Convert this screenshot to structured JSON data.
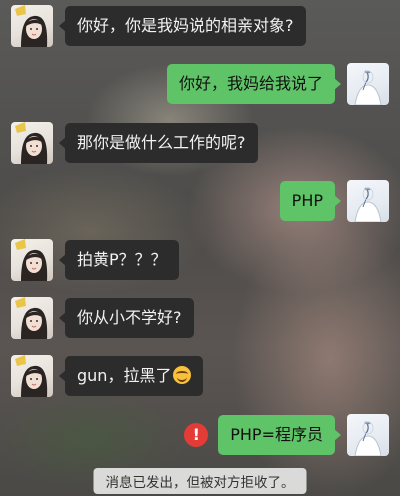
{
  "chat": {
    "messages": [
      {
        "side": "left",
        "text": "你好，你是我妈说的相亲对象?"
      },
      {
        "side": "right",
        "text": "你好，我妈给我说了"
      },
      {
        "side": "left",
        "text": "那你是做什么工作的呢?"
      },
      {
        "side": "right",
        "text": "PHP"
      },
      {
        "side": "left",
        "text": "拍黄P？？？"
      },
      {
        "side": "left",
        "text": "你从小不学好?"
      },
      {
        "side": "left",
        "text": "gun，拉黑了",
        "emoji": "smile-emoji"
      },
      {
        "side": "right",
        "text": "PHP=程序员",
        "status": "send-failed-icon"
      }
    ],
    "system_notice": "消息已发出，但被对方拒收了。",
    "warning_glyph": "!"
  },
  "colors": {
    "incoming_bubble": "#2c2c2c",
    "outgoing_bubble": "#5fc368",
    "error": "#e33b36"
  }
}
